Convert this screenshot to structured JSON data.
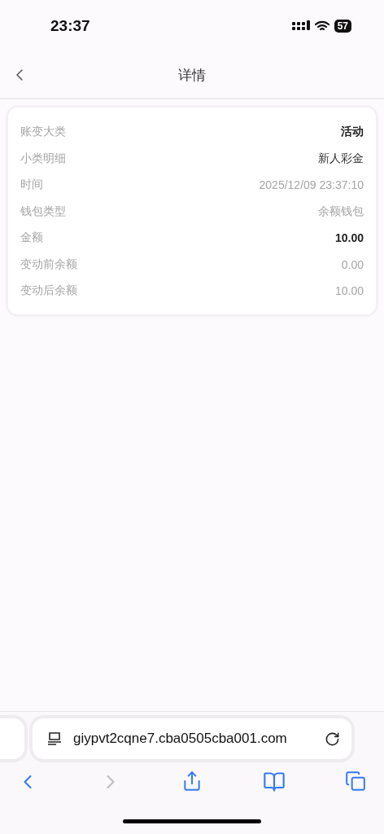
{
  "status_bar": {
    "time": "23:37",
    "battery": "57"
  },
  "header": {
    "title": "详情"
  },
  "details": [
    {
      "label": "账变大类",
      "value": "活动",
      "kind": "strong"
    },
    {
      "label": "小类明细",
      "value": "新人彩金",
      "kind": "normal"
    },
    {
      "label": "时间",
      "value": "2025/12/09 23:37:10",
      "kind": "muted"
    },
    {
      "label": "钱包类型",
      "value": "余额钱包",
      "kind": "muted"
    },
    {
      "label": "金额",
      "value": "10.00",
      "kind": "strong"
    },
    {
      "label": "变动前余额",
      "value": "0.00",
      "kind": "muted"
    },
    {
      "label": "变动后余额",
      "value": "10.00",
      "kind": "muted"
    }
  ],
  "browser": {
    "url": "giypvt2cqne7.cba0505cba001.com",
    "back_disabled": false,
    "forward_disabled": true
  }
}
